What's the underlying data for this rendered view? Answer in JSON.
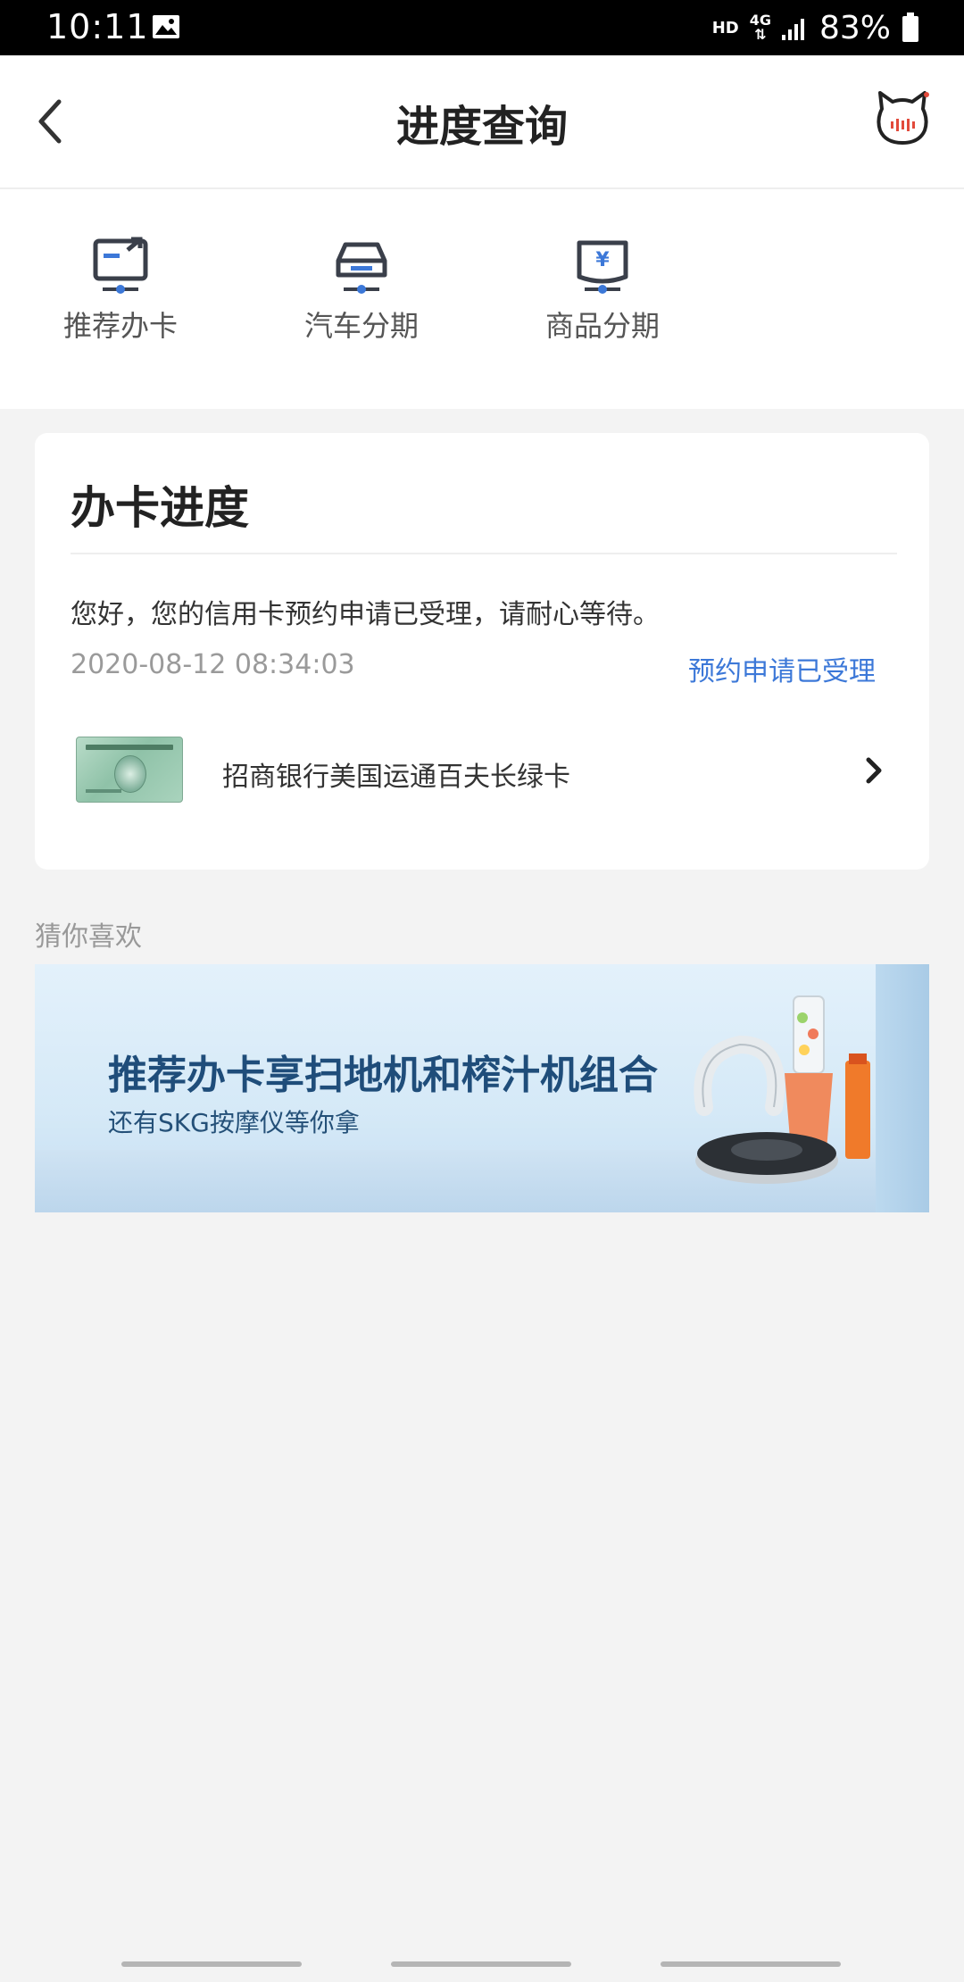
{
  "status_bar": {
    "time": "10:11",
    "hd": "HD",
    "network": "4G",
    "battery": "83%"
  },
  "header": {
    "title": "进度查询",
    "back_icon": "chevron-left-icon",
    "assistant_icon": "cat-mascot-icon"
  },
  "quick_tabs": [
    {
      "label": "推荐办卡",
      "icon": "recommend-card-icon"
    },
    {
      "label": "汽车分期",
      "icon": "car-icon"
    },
    {
      "label": "商品分期",
      "icon": "yuan-box-icon"
    }
  ],
  "progress_card": {
    "title": "办卡进度",
    "message": "您好，您的信用卡预约申请已受理，请耐心等待。",
    "timestamp": "2020-08-12 08:34:03",
    "status": "预约申请已受理",
    "card_name": "招商银行美国运通百夫长绿卡"
  },
  "recommend": {
    "title": "猜你喜欢",
    "banner": {
      "headline": "推荐办卡享扫地机和榨汁机组合",
      "sub": "还有SKG按摩仪等你拿"
    }
  },
  "colors": {
    "accent": "#3c78d8",
    "page_bg": "#f3f3f3",
    "banner_text": "#1f4d7a"
  }
}
